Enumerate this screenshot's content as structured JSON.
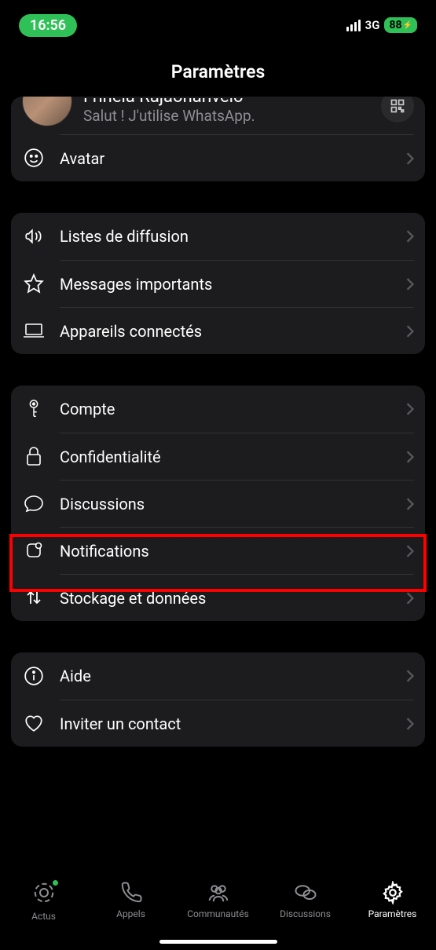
{
  "status": {
    "time": "16:56",
    "network": "3G",
    "battery": "88"
  },
  "header": {
    "title": "Paramètres"
  },
  "profile": {
    "name": "Frinela Rajaonarivelo",
    "status": "Salut ! J'utilise WhatsApp."
  },
  "group1": {
    "avatar": "Avatar"
  },
  "group2": {
    "broadcast": "Listes de diffusion",
    "starred": "Messages importants",
    "linked": "Appareils connectés"
  },
  "group3": {
    "account": "Compte",
    "privacy": "Confidentialité",
    "chats": "Discussions",
    "notifications": "Notifications",
    "storage": "Stockage et données"
  },
  "group4": {
    "help": "Aide",
    "invite": "Inviter un contact"
  },
  "tabs": {
    "updates": "Actus",
    "calls": "Appels",
    "communities": "Communautés",
    "chats": "Discussions",
    "settings": "Paramètres"
  }
}
